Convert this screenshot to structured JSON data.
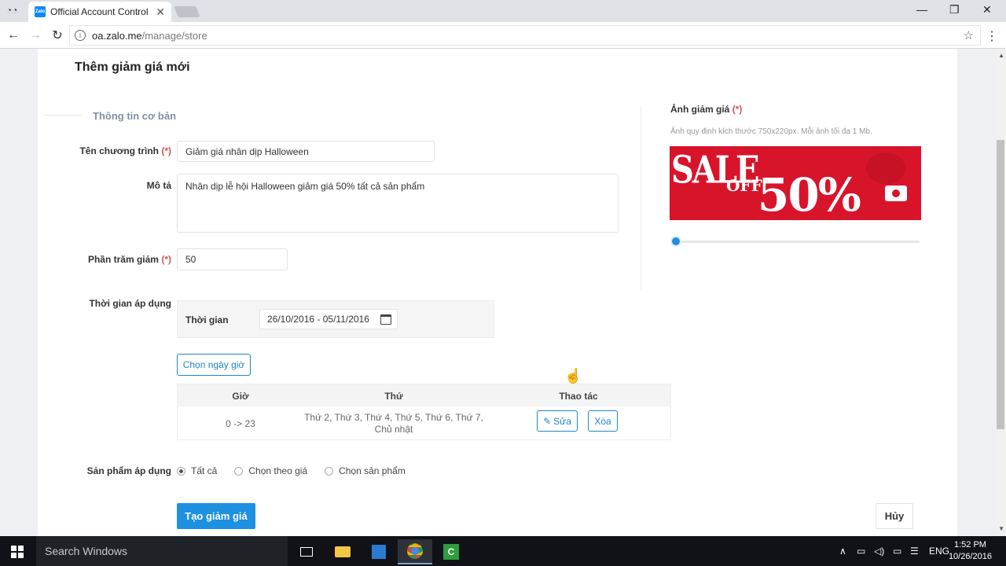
{
  "browser": {
    "tab_title": "Official Account Control",
    "tab_favicon_text": "Zalo",
    "url_host": "oa.zalo.me",
    "url_path": "/manage/store"
  },
  "page": {
    "title": "Thêm giảm giá mới",
    "section_title": "Thông tin cơ bản",
    "required_mark": "(*)",
    "program_name": {
      "label": "Tên chương trình",
      "value": "Giảm giá nhân dịp Halloween"
    },
    "description": {
      "label": "Mô tả",
      "value": "Nhân dịp lễ hội Halloween giảm giá 50% tất cả sản phẩm"
    },
    "percent": {
      "label": "Phần trăm giảm",
      "value": "50"
    },
    "apply_time": {
      "label": "Thời gian áp dụng",
      "time_label": "Thời gian",
      "date_range": "26/10/2016 - 05/11/2016",
      "choose_button": "Chọn ngày giờ"
    },
    "schedule": {
      "headers": [
        "Giờ",
        "Thứ",
        "Thao tác"
      ],
      "rows": [
        {
          "hours": "0 -> 23",
          "days_line1": "Thứ 2, Thứ 3, Thứ 4, Thứ 5, Thứ 6, Thứ 7,",
          "days_line2": "Chủ nhật",
          "edit": "Sửa",
          "delete": "Xóa"
        }
      ]
    },
    "products": {
      "label": "Sản phẩm áp dụng",
      "options": [
        "Tất cả",
        "Chọn theo giá",
        "Chọn sản phẩm"
      ],
      "selected": "Tất cả"
    },
    "submit_button": "Tạo giảm giá",
    "cancel_button": "Hủy",
    "image": {
      "title": "Ảnh giảm giá",
      "hint": "Ảnh quy định kích thước 750x220px. Mỗi ảnh tối đa 1 Mb.",
      "banner_sale": "SALE",
      "banner_off": "OFF",
      "banner_percent": "50%",
      "zoom_level": 0
    }
  },
  "taskbar": {
    "search_placeholder": "Search Windows",
    "language": "ENG",
    "time": "1:52 PM",
    "date": "10/26/2016"
  },
  "colors": {
    "primary": "#1e90e0",
    "required": "#d9534f",
    "banner": "#d8142b"
  }
}
